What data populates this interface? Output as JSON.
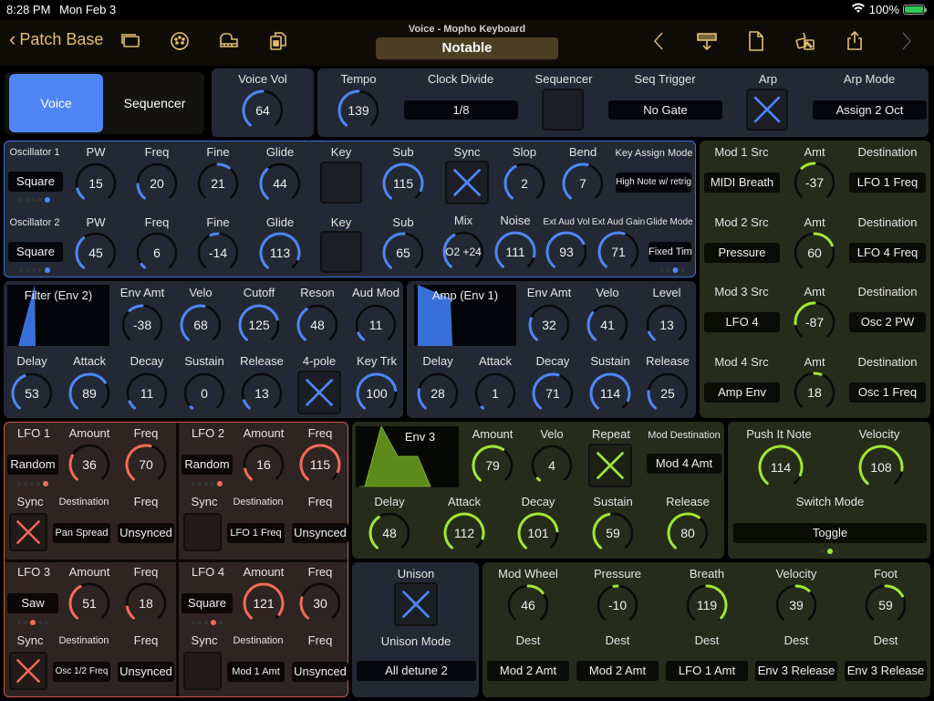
{
  "status_bar": {
    "time": "8:28 PM",
    "date": "Mon Feb 3",
    "battery": "100%"
  },
  "nav": {
    "back_label": "Patch Base",
    "subtitle": "Voice - Mopho Keyboard",
    "patch_name": "Notable",
    "left_icons": [
      "windows-icon",
      "midi-port-icon",
      "piano-icon",
      "copy-document-icon"
    ],
    "right_icons": [
      "chevron-left-icon",
      "keyboard-download-icon",
      "new-document-icon",
      "dice-icon",
      "share-icon",
      "chevron-right-icon"
    ]
  },
  "colors": {
    "blue": "#4f86f7",
    "red": "#f36b57",
    "green": "#a3e635",
    "gold": "#e2bf6e"
  },
  "mode_tabs": {
    "voice": "Voice",
    "sequencer": "Sequencer",
    "selected": "Voice"
  },
  "voice_vol": {
    "label": "Voice Vol",
    "value": 64,
    "max": 127
  },
  "top": {
    "tempo": {
      "label": "Tempo",
      "value": 139,
      "min": 30,
      "max": 250
    },
    "clock_divide": {
      "label": "Clock Divide",
      "value": "1/8"
    },
    "sequencer": {
      "label": "Sequencer",
      "on": false
    },
    "seq_trigger": {
      "label": "Seq Trigger",
      "value": "No Gate"
    },
    "arp": {
      "label": "Arp",
      "on": true
    },
    "arp_mode": {
      "label": "Arp Mode",
      "value": "Assign 2 Oct"
    }
  },
  "osc1": {
    "title": "Oscillator 1",
    "shape": "Square",
    "shape_index": 4,
    "shape_count": 5,
    "pw": {
      "label": "PW",
      "value": 15,
      "frac": 0.12
    },
    "freq": {
      "label": "Freq",
      "value": 20,
      "frac": 0.17
    },
    "fine": {
      "label": "Fine",
      "value": 21,
      "bipolar": true,
      "frac": 0.63
    },
    "glide": {
      "label": "Glide",
      "value": 44,
      "frac": 0.35
    },
    "key": {
      "label": "Key",
      "on": false
    },
    "sub": {
      "label": "Sub",
      "value": 115,
      "frac": 0.9
    }
  },
  "osc2": {
    "title": "Oscillator 2",
    "shape": "Square",
    "shape_index": 4,
    "shape_count": 5,
    "pw": {
      "label": "PW",
      "value": 45,
      "frac": 0.36
    },
    "freq": {
      "label": "Freq",
      "value": 6,
      "frac": 0.05
    },
    "fine": {
      "label": "Fine",
      "value": -14,
      "bipolar": true,
      "frac": 0.42
    },
    "glide": {
      "label": "Glide",
      "value": 113,
      "frac": 0.89
    },
    "key": {
      "label": "Key",
      "on": false
    },
    "sub": {
      "label": "Sub",
      "value": 65,
      "frac": 0.51
    }
  },
  "osc_common": {
    "sync": {
      "label": "Sync",
      "on": true
    },
    "slop": {
      "label": "Slop",
      "value": 2,
      "frac": 0.4
    },
    "bend": {
      "label": "Bend",
      "value": 7,
      "frac": 0.55
    },
    "key_assign": {
      "label": "Key Assign Mode",
      "value": "High Note w/ retrig"
    },
    "mix": {
      "label": "Mix",
      "value": "O2 +24",
      "frac": 0.4
    },
    "noise": {
      "label": "Noise",
      "value": 111,
      "frac": 0.87
    },
    "ext_vol": {
      "label": "Ext Aud Vol",
      "value": 93,
      "frac": 0.73
    },
    "ext_gain": {
      "label": "Ext Aud Gain",
      "value": 71,
      "frac": 0.56
    },
    "glide_mode": {
      "label": "Glide Mode",
      "value": "Fixed Time"
    },
    "page_index": 2,
    "page_count": 4
  },
  "filter": {
    "title": "Filter (Env 2)",
    "env_amt": {
      "label": "Env Amt",
      "value": -38,
      "bipolar": true,
      "frac": 0.35
    },
    "velo": {
      "label": "Velo",
      "value": 68,
      "frac": 0.54
    },
    "cutoff": {
      "label": "Cutoff",
      "value": 125,
      "frac": 0.76
    },
    "reson": {
      "label": "Reson",
      "value": 48,
      "frac": 0.38
    },
    "aud_mod": {
      "label": "Aud Mod",
      "value": 11,
      "frac": 0.09
    },
    "delay": {
      "label": "Delay",
      "value": 53,
      "frac": 0.42
    },
    "attack": {
      "label": "Attack",
      "value": 89,
      "frac": 0.7
    },
    "decay": {
      "label": "Decay",
      "value": 11,
      "frac": 0.09
    },
    "sustain": {
      "label": "Sustain",
      "value": 0,
      "frac": 0
    },
    "release": {
      "label": "Release",
      "value": 13,
      "frac": 0.1
    },
    "four_pole": {
      "label": "4-pole",
      "on": true
    },
    "key_trk": {
      "label": "Key Trk",
      "value": 100,
      "frac": 0.79
    }
  },
  "amp": {
    "title": "Amp (Env 1)",
    "env_amt": {
      "label": "Env Amt",
      "value": 32,
      "frac": 0.25
    },
    "velo": {
      "label": "Velo",
      "value": 41,
      "frac": 0.32
    },
    "level": {
      "label": "Level",
      "value": 13,
      "frac": 0.1
    },
    "delay": {
      "label": "Delay",
      "value": 28,
      "frac": 0.22
    },
    "attack": {
      "label": "Attack",
      "value": 1,
      "frac": 0.01
    },
    "decay": {
      "label": "Decay",
      "value": 71,
      "frac": 0.56
    },
    "sustain": {
      "label": "Sustain",
      "value": 114,
      "frac": 0.9
    },
    "release": {
      "label": "Release",
      "value": 25,
      "frac": 0.2
    }
  },
  "lfos": [
    {
      "title": "LFO 1",
      "shape": "Random",
      "shape_index": 4,
      "amount_label": "Amount",
      "amount": 36,
      "amount_frac": 0.28,
      "freq_label": "Freq",
      "freq": 70,
      "freq_frac": 0.55,
      "sync_label": "Sync",
      "sync": true,
      "dest_label": "Destination",
      "dest": "Pan Spread",
      "freq_mode_label": "Freq",
      "freq_mode": "Unsynced"
    },
    {
      "title": "LFO 2",
      "shape": "Random",
      "shape_index": 4,
      "amount_label": "Amount",
      "amount": 16,
      "amount_frac": 0.13,
      "freq_label": "Freq",
      "freq": 115,
      "freq_frac": 0.9,
      "sync_label": "Sync",
      "sync": false,
      "dest_label": "Destination",
      "dest": "LFO 1 Freq",
      "freq_mode_label": "Freq",
      "freq_mode": "Unsynced"
    },
    {
      "title": "LFO 3",
      "shape": "Saw",
      "shape_index": 2,
      "amount_label": "Amount",
      "amount": 51,
      "amount_frac": 0.4,
      "freq_label": "Freq",
      "freq": 18,
      "freq_frac": 0.14,
      "sync_label": "Sync",
      "sync": true,
      "dest_label": "Destination",
      "dest": "Osc 1/2 Freq",
      "freq_mode_label": "Freq",
      "freq_mode": "Unsynced"
    },
    {
      "title": "LFO 4",
      "shape": "Square",
      "shape_index": 3,
      "amount_label": "Amount",
      "amount": 121,
      "amount_frac": 0.95,
      "freq_label": "Freq",
      "freq": 30,
      "freq_frac": 0.24,
      "sync_label": "Sync",
      "sync": false,
      "dest_label": "Destination",
      "dest": "Mod 1 Amt",
      "freq_mode_label": "Freq",
      "freq_mode": "Unsynced"
    }
  ],
  "env3": {
    "title": "Env 3",
    "amount": {
      "label": "Amount",
      "value": 79,
      "frac": 0.62
    },
    "velo": {
      "label": "Velo",
      "value": 4,
      "frac": 0.03
    },
    "repeat": {
      "label": "Repeat",
      "on": true
    },
    "mod_dest": {
      "label": "Mod Destination",
      "value": "Mod 4 Amt"
    },
    "delay": {
      "label": "Delay",
      "value": 48,
      "frac": 0.38
    },
    "attack": {
      "label": "Attack",
      "value": 112,
      "frac": 0.88
    },
    "decay": {
      "label": "Decay",
      "value": 101,
      "frac": 0.8
    },
    "sustain": {
      "label": "Sustain",
      "value": 59,
      "frac": 0.46
    },
    "release": {
      "label": "Release",
      "value": 80,
      "frac": 0.63
    }
  },
  "mods": [
    {
      "src_label": "Mod 1 Src",
      "src": "MIDI Breath",
      "amt_label": "Amt",
      "amt": -37,
      "frac": 0.35,
      "dest_label": "Destination",
      "dest": "LFO 1 Freq"
    },
    {
      "src_label": "Mod 2 Src",
      "src": "Pressure",
      "amt_label": "Amt",
      "amt": 60,
      "frac": 0.74,
      "dest_label": "Destination",
      "dest": "LFO 4 Freq"
    },
    {
      "src_label": "Mod 3 Src",
      "src": "LFO 4",
      "amt_label": "Amt",
      "amt": -87,
      "frac": 0.16,
      "dest_label": "Destination",
      "dest": "Osc 2 PW"
    },
    {
      "src_label": "Mod 4 Src",
      "src": "Amp Env",
      "amt_label": "Amt",
      "amt": 18,
      "frac": 0.57,
      "dest_label": "Destination",
      "dest": "Osc 1 Freq"
    }
  ],
  "push_it": {
    "note_label": "Push It Note",
    "note": 114,
    "note_frac": 0.9,
    "velocity_label": "Velocity",
    "velocity": 108,
    "velocity_frac": 0.85,
    "switch_mode_label": "Switch Mode",
    "switch_mode": "Toggle",
    "page_index": 1,
    "page_count": 3
  },
  "unison": {
    "label": "Unison",
    "on": true,
    "mode_label": "Unison Mode",
    "mode": "All detune 2"
  },
  "controllers": [
    {
      "label": "Mod Wheel",
      "value": 46,
      "frac": 0.68,
      "dest_label": "Dest",
      "dest": "Mod 2 Amt"
    },
    {
      "label": "Pressure",
      "value": -10,
      "frac": 0.46,
      "dest_label": "Dest",
      "dest": "Mod 2 Amt"
    },
    {
      "label": "Breath",
      "value": 119,
      "frac": 0.97,
      "dest_label": "Dest",
      "dest": "LFO 1 Amt"
    },
    {
      "label": "Velocity",
      "value": 39,
      "frac": 0.65,
      "dest_label": "Dest",
      "dest": "Env 3 Release"
    },
    {
      "label": "Foot",
      "value": 59,
      "frac": 0.72,
      "dest_label": "Dest",
      "dest": "Env 3 Release"
    }
  ]
}
